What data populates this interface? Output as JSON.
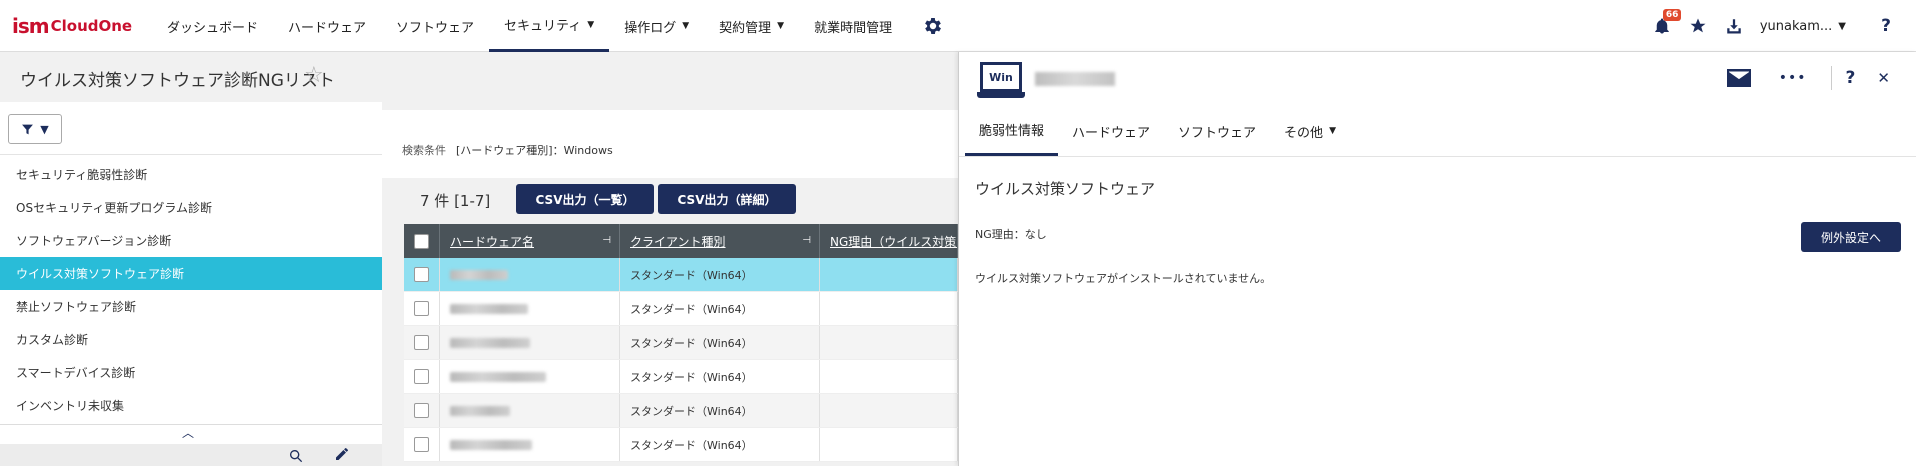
{
  "header": {
    "logo_ism": "ism",
    "logo_cloud": "CloudOne",
    "nav": [
      {
        "label": "ダッシュボード",
        "caret": ""
      },
      {
        "label": "ハードウェア",
        "caret": ""
      },
      {
        "label": "ソフトウェア",
        "caret": ""
      },
      {
        "label": "セキュリティ",
        "caret": "▼"
      },
      {
        "label": "操作ログ",
        "caret": "▼"
      },
      {
        "label": "契約管理",
        "caret": "▼"
      },
      {
        "label": "就業時間管理",
        "caret": ""
      }
    ],
    "notification_count": "66",
    "username": "yunakam...",
    "user_caret": "▼",
    "help": "?"
  },
  "page": {
    "title": "ウイルス対策ソフトウェア診断NGリスト",
    "favorite_icon": "☆"
  },
  "sidebar": {
    "filter_caret": "▼",
    "items": [
      "セキュリティ脆弱性診断",
      "OSセキュリティ更新プログラム診断",
      "ソフトウェアバージョン診断",
      "ウイルス対策ソフトウェア診断",
      "禁止ソフトウェア診断",
      "カスタム診断",
      "スマートデバイス診断",
      "インベントリ未収集"
    ],
    "collapse_icon": "︿"
  },
  "main": {
    "condition_label": "検索条件",
    "condition_value": "[ハードウェア種別]：Windows",
    "count": "7 件 [1-7]",
    "csv_summary": "CSV出力（一覧）",
    "csv_detail": "CSV出力（詳細）",
    "columns": {
      "hardware_name": "ハードウェア名",
      "client_type": "クライアント種別",
      "ng_reason": "NG理由（ウイルス対策ソフ"
    },
    "rows": [
      {
        "client_type": "スタンダード（Win64）"
      },
      {
        "client_type": "スタンダード（Win64）"
      },
      {
        "client_type": "スタンダード（Win64）"
      },
      {
        "client_type": "スタンダード（Win64）"
      },
      {
        "client_type": "スタンダード（Win64）"
      },
      {
        "client_type": "スタンダード（Win64）"
      }
    ]
  },
  "panel": {
    "os_badge": "Win",
    "tabs": [
      {
        "label": "脆弱性情報",
        "caret": ""
      },
      {
        "label": "ハードウェア",
        "caret": ""
      },
      {
        "label": "ソフトウェア",
        "caret": ""
      },
      {
        "label": "その他",
        "caret": "▼"
      }
    ],
    "section_title": "ウイルス対策ソフトウェア",
    "ng_reason": "NG理由：なし",
    "exception_button": "例外設定へ",
    "message": "ウイルス対策ソフトウェアがインストールされていません。",
    "more": "•••",
    "help": "?",
    "close": "✕"
  },
  "colors": {
    "brand": "#c8102e",
    "navy": "#1d2d5c",
    "active_side": "#29bcd8",
    "selected_row": "#8fdff0"
  }
}
